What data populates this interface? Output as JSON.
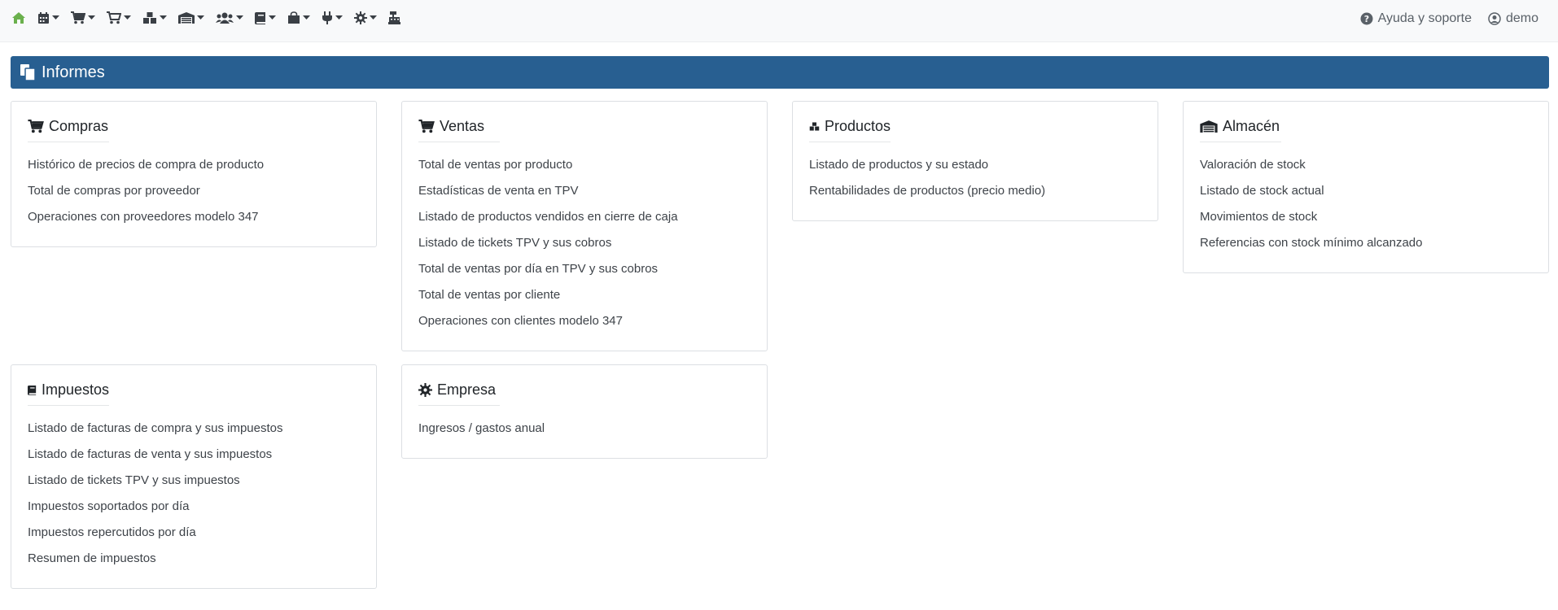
{
  "colors": {
    "home_accent": "#6ab04c",
    "header_bg": "#285f91",
    "icon_dark": "#3a3f45"
  },
  "navbar": {
    "icons": [
      "home-icon",
      "calendar-icon",
      "shopping-cart-icon",
      "cart-arrow-icon",
      "cubes-icon",
      "warehouse-icon",
      "users-icon",
      "book-icon",
      "shopping-bag-icon",
      "plug-icon",
      "cog-icon",
      "cash-register-icon"
    ],
    "help_label": "Ayuda y soporte",
    "user_label": "demo"
  },
  "header": {
    "title": "Informes"
  },
  "cards": {
    "compras": {
      "title": "Compras",
      "links": [
        "Histórico de precios de compra de producto",
        "Total de compras por proveedor",
        "Operaciones con proveedores modelo 347"
      ]
    },
    "ventas": {
      "title": "Ventas",
      "links": [
        "Total de ventas por producto",
        "Estadísticas de venta en TPV",
        "Listado de productos vendidos en cierre de caja",
        "Listado de tickets TPV y sus cobros",
        "Total de ventas por día en TPV y sus cobros",
        "Total de ventas por cliente",
        "Operaciones con clientes modelo 347"
      ]
    },
    "productos": {
      "title": "Productos",
      "links": [
        "Listado de productos y su estado",
        "Rentabilidades de productos (precio medio)"
      ]
    },
    "almacen": {
      "title": "Almacén",
      "links": [
        "Valoración de stock",
        "Listado de stock actual",
        "Movimientos de stock",
        "Referencias con stock mínimo alcanzado"
      ]
    },
    "impuestos": {
      "title": "Impuestos",
      "links": [
        "Listado de facturas de compra y sus impuestos",
        "Listado de facturas de venta y sus impuestos",
        "Listado de tickets TPV y sus impuestos",
        "Impuestos soportados por día",
        "Impuestos repercutidos por día",
        "Resumen de impuestos"
      ]
    },
    "empresa": {
      "title": "Empresa",
      "links": [
        "Ingresos / gastos anual"
      ]
    }
  }
}
